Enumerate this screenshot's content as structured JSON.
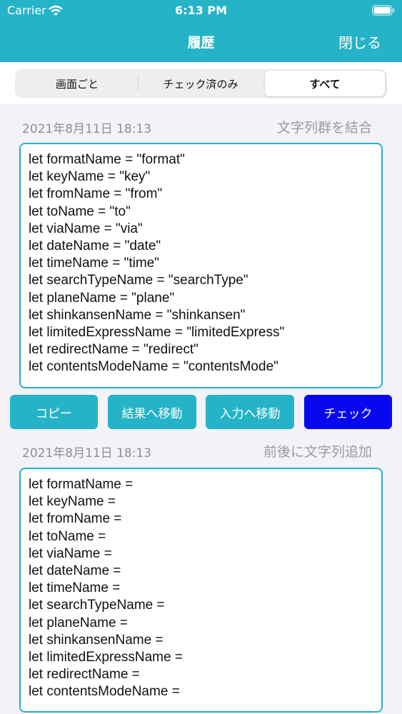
{
  "status": {
    "carrier": "Carrier",
    "time": "6:13 PM",
    "wifi_icon": "wifi-icon",
    "battery_icon": "battery-icon"
  },
  "nav": {
    "title": "履歴",
    "close_label": "閉じる",
    "color": "#25b3c7"
  },
  "segments": [
    {
      "label": "画面ごと",
      "selected": false
    },
    {
      "label": "チェック済のみ",
      "selected": false
    },
    {
      "label": "すべて",
      "selected": true
    }
  ],
  "entries": [
    {
      "date": "2021年8月11日 18:13",
      "type": "文字列群を結合",
      "lines": [
        "let formatName = \"format\"",
        "let keyName = \"key\"",
        "let fromName = \"from\"",
        "let toName = \"to\"",
        "let viaName = \"via\"",
        "let dateName = \"date\"",
        "let timeName = \"time\"",
        "let searchTypeName = \"searchType\"",
        "let planeName = \"plane\"",
        "let shinkansenName = \"shinkansen\"",
        "let limitedExpressName = \"limitedExpress\"",
        "let redirectName = \"redirect\"",
        "let contentsModeName = \"contentsMode\""
      ]
    },
    {
      "date": "2021年8月11日 18:13",
      "type": "前後に文字列追加",
      "lines": [
        "let formatName =",
        "let keyName =",
        "let fromName =",
        "let toName =",
        "let viaName =",
        "let dateName =",
        "let timeName =",
        "let searchTypeName =",
        "let planeName =",
        "let shinkansenName =",
        "let limitedExpressName =",
        "let redirectName =",
        "let contentsModeName ="
      ]
    }
  ],
  "actions": {
    "copy": "コピー",
    "to_result": "結果へ移動",
    "to_input": "入力へ移動",
    "check": "チェック",
    "accent": "#25b3c7",
    "check_color": "#0808ee"
  }
}
